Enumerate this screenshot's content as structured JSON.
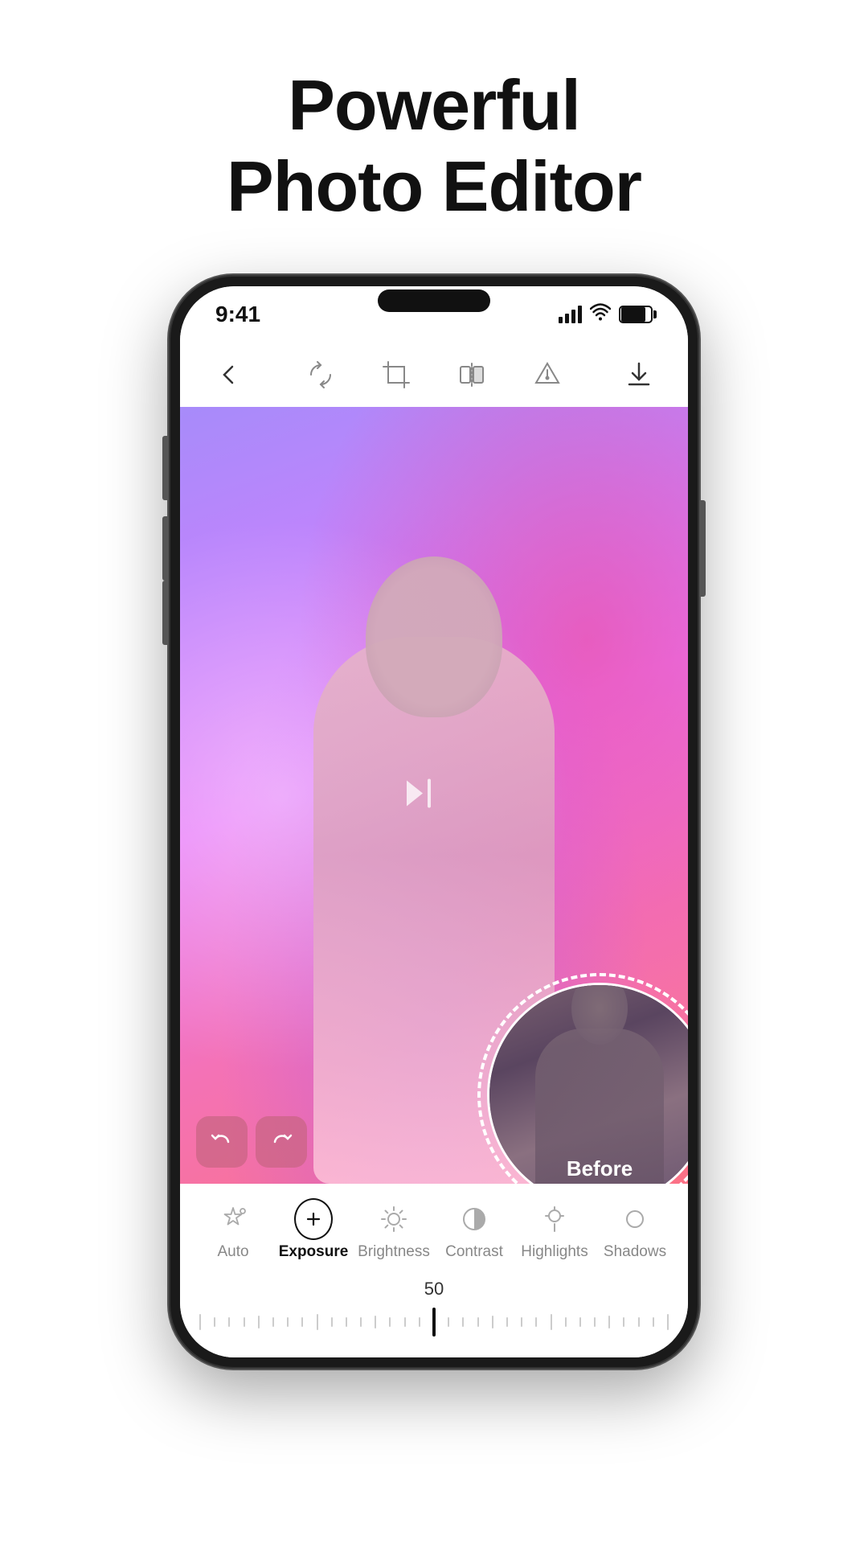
{
  "page": {
    "title_line1": "Powerful",
    "title_line2": "Photo Editor"
  },
  "status_bar": {
    "time": "9:41",
    "signal_label": "signal",
    "wifi_label": "wifi",
    "battery_label": "battery"
  },
  "toolbar": {
    "back_label": "back",
    "rotate_label": "rotate",
    "crop_label": "crop",
    "flip_label": "flip",
    "adjust_label": "adjust",
    "download_label": "download"
  },
  "photo": {
    "before_label": "Before"
  },
  "tools": [
    {
      "id": "auto",
      "label": "Auto",
      "icon": "auto",
      "active": false
    },
    {
      "id": "exposure",
      "label": "Exposure",
      "icon": "plus-circle",
      "active": true
    },
    {
      "id": "brightness",
      "label": "Brightness",
      "icon": "sun",
      "active": false
    },
    {
      "id": "contrast",
      "label": "Contrast",
      "icon": "contrast",
      "active": false
    },
    {
      "id": "highlights",
      "label": "Highlights",
      "icon": "highlights",
      "active": false
    },
    {
      "id": "shadows",
      "label": "Shadows",
      "icon": "shadows",
      "active": false
    }
  ],
  "slider": {
    "value": "50",
    "min": -100,
    "max": 100,
    "current": 50
  },
  "colors": {
    "accent": "#111111",
    "active_tool": "#111111",
    "inactive_tool": "#888888",
    "photo_bg_start": "#a78bfa",
    "photo_bg_end": "#fb7185"
  }
}
